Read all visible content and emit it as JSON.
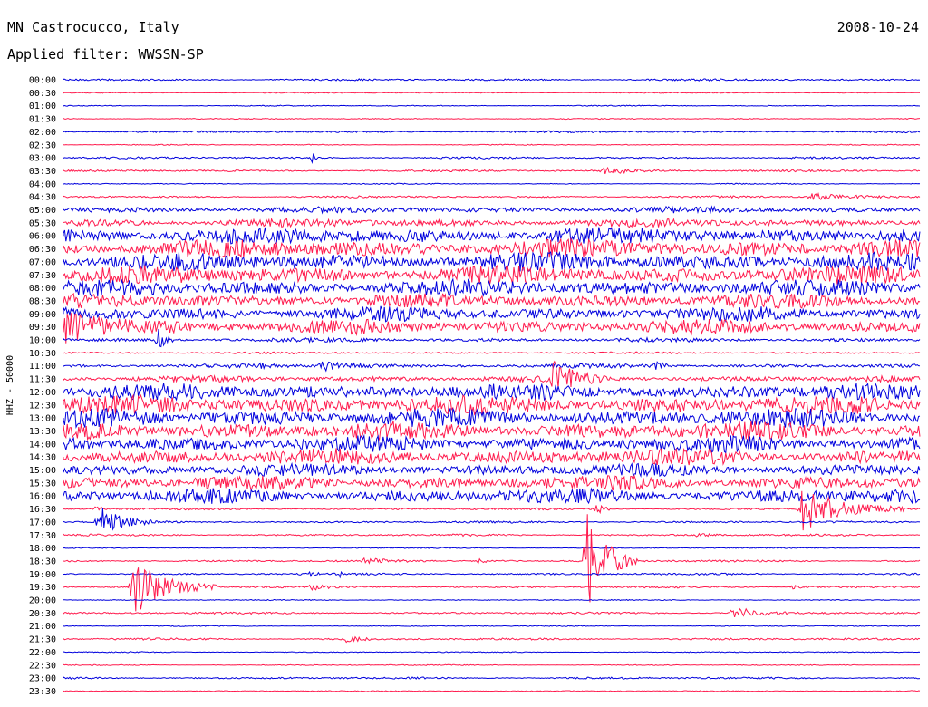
{
  "header": {
    "station": "MN Castrocucco, Italy",
    "date": "2008-10-24",
    "filter": "Applied filter: WWSSN-SP"
  },
  "colors": {
    "blue": "#0000dd",
    "red": "#ff1a4d",
    "background": "#ffffff"
  },
  "chart_data": {
    "type": "line",
    "title": "MN Castrocucco, Italy",
    "subtitle": "Applied filter: WWSSN-SP",
    "date": "2008-10-24",
    "ylabel": "HHZ - 50000",
    "xlabel": "",
    "grid": false,
    "rows": [
      "00:00",
      "00:30",
      "01:00",
      "01:30",
      "02:00",
      "02:30",
      "03:00",
      "03:30",
      "04:00",
      "04:30",
      "05:00",
      "05:30",
      "06:00",
      "06:30",
      "07:00",
      "07:30",
      "08:00",
      "08:30",
      "09:00",
      "09:30",
      "10:00",
      "10:30",
      "11:00",
      "11:30",
      "12:00",
      "12:30",
      "13:00",
      "13:30",
      "14:00",
      "14:30",
      "15:00",
      "15:30",
      "16:00",
      "16:30",
      "17:00",
      "17:30",
      "18:00",
      "18:30",
      "19:00",
      "19:30",
      "20:00",
      "20:30",
      "21:00",
      "21:30",
      "22:00",
      "22:30",
      "23:00",
      "23:30"
    ],
    "row_colors": "alternating blue (even) / red (odd)",
    "noise_level": [
      1,
      0.5,
      0.5,
      0.5,
      1,
      0.5,
      1,
      1,
      0.5,
      1,
      3,
      4,
      8,
      9,
      9,
      9,
      8,
      7,
      7,
      7,
      2,
      1,
      2,
      3,
      8,
      9,
      9,
      9,
      8,
      8,
      6,
      7,
      7,
      1,
      1,
      1,
      0.5,
      1,
      1,
      1,
      0.5,
      1,
      0.5,
      1,
      0.5,
      0.5,
      1,
      0.5
    ],
    "events": [
      {
        "row": "03:00",
        "x_fraction": 0.29,
        "amp": 6,
        "dur": 0.01
      },
      {
        "row": "03:30",
        "x_fraction": 0.63,
        "amp": 3,
        "dur": 0.12
      },
      {
        "row": "04:30",
        "x_fraction": 0.87,
        "amp": 4,
        "dur": 0.12
      },
      {
        "row": "09:30",
        "x_fraction": 0.0,
        "amp": 14,
        "dur": 0.14
      },
      {
        "row": "10:00",
        "x_fraction": 0.11,
        "amp": 14,
        "dur": 0.02
      },
      {
        "row": "11:00",
        "x_fraction": 0.23,
        "amp": 6,
        "dur": 0.01
      },
      {
        "row": "11:00",
        "x_fraction": 0.3,
        "amp": 5,
        "dur": 0.1
      },
      {
        "row": "11:00",
        "x_fraction": 0.69,
        "amp": 9,
        "dur": 0.02
      },
      {
        "row": "11:30",
        "x_fraction": 0.57,
        "amp": 18,
        "dur": 0.07
      },
      {
        "row": "16:30",
        "x_fraction": 0.04,
        "amp": 6,
        "dur": 0.01
      },
      {
        "row": "16:30",
        "x_fraction": 0.62,
        "amp": 10,
        "dur": 0.02
      },
      {
        "row": "16:30",
        "x_fraction": 0.86,
        "amp": 26,
        "dur": 0.12
      },
      {
        "row": "17:00",
        "x_fraction": 0.04,
        "amp": 18,
        "dur": 0.07
      },
      {
        "row": "17:30",
        "x_fraction": 0.74,
        "amp": 3,
        "dur": 0.03
      },
      {
        "row": "18:30",
        "x_fraction": 0.35,
        "amp": 3,
        "dur": 0.06
      },
      {
        "row": "18:30",
        "x_fraction": 0.48,
        "amp": 3,
        "dur": 0.05
      },
      {
        "row": "18:30",
        "x_fraction": 0.61,
        "amp": 60,
        "dur": 0.06
      },
      {
        "row": "19:00",
        "x_fraction": 0.29,
        "amp": 6,
        "dur": 0.01
      },
      {
        "row": "19:00",
        "x_fraction": 0.32,
        "amp": 6,
        "dur": 0.01
      },
      {
        "row": "19:30",
        "x_fraction": 0.08,
        "amp": 32,
        "dur": 0.1
      },
      {
        "row": "19:30",
        "x_fraction": 0.29,
        "amp": 3,
        "dur": 0.03
      },
      {
        "row": "19:30",
        "x_fraction": 0.85,
        "amp": 3,
        "dur": 0.03
      },
      {
        "row": "20:30",
        "x_fraction": 0.78,
        "amp": 8,
        "dur": 0.07
      },
      {
        "row": "21:30",
        "x_fraction": 0.33,
        "amp": 6,
        "dur": 0.03
      }
    ]
  }
}
